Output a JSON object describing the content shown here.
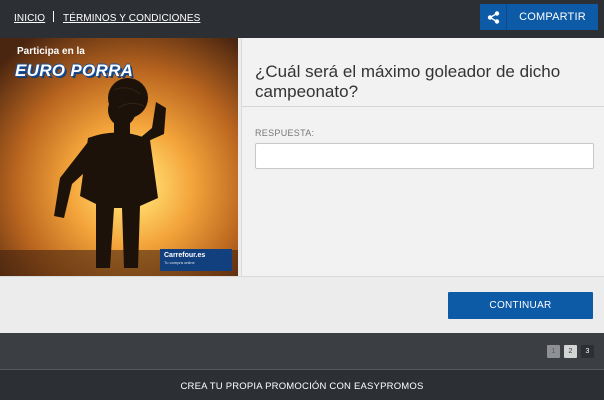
{
  "nav": {
    "home": "INICIO",
    "terms": "TÉRMINOS Y CONDICIONES"
  },
  "share": {
    "label": "COMPARTIR",
    "icon": "share-icon"
  },
  "promo": {
    "kicker": "Participa en la",
    "title": "EURO PORRA",
    "logo_name": "Carrefour.es",
    "logo_tag": "Tu compra online"
  },
  "question": {
    "text": "¿Cuál será el máximo goleador de dicho campeonato?",
    "answer_label": "RESPUESTA:",
    "answer_value": "",
    "answer_placeholder": ""
  },
  "actions": {
    "continue_label": "CONTINUAR"
  },
  "pagination": {
    "pages": [
      "1",
      "2",
      "3"
    ],
    "current": "3"
  },
  "footer": {
    "text": "CREA TU PROPIA PROMOCIÓN CON EASYPROMOS"
  },
  "colors": {
    "primary": "#0d5aa7",
    "topbar": "#2c2f34",
    "panel": "#f2f2f2"
  }
}
